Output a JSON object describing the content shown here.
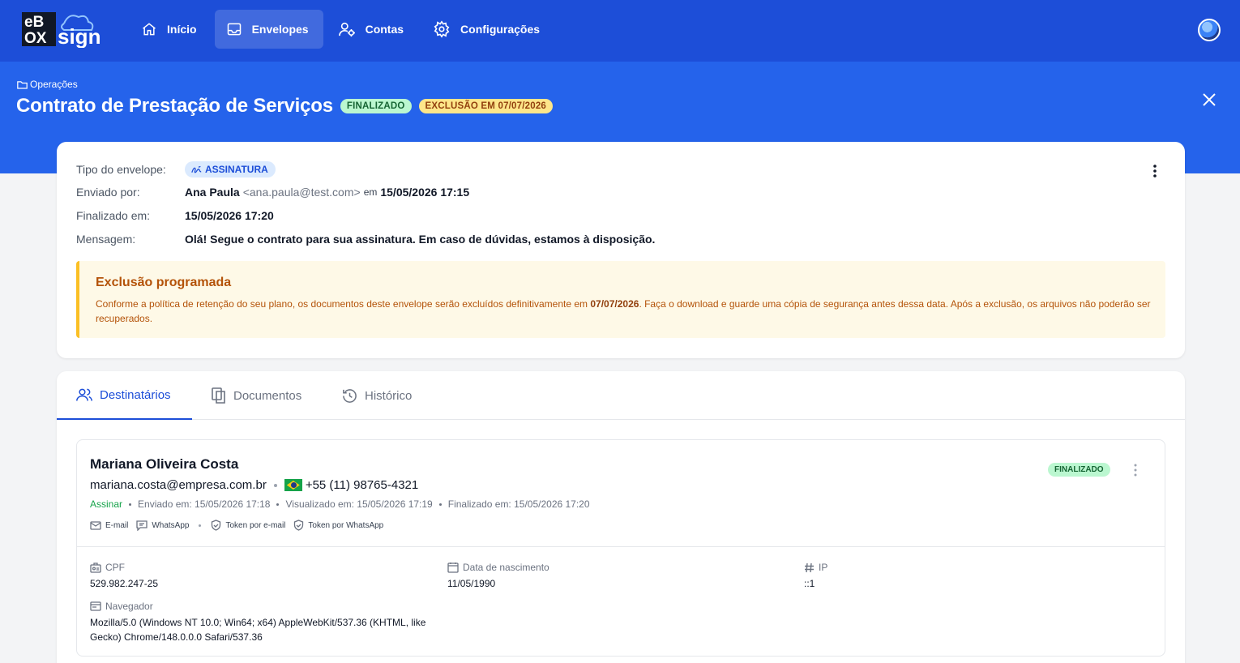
{
  "app": {
    "logo": {
      "line1": "eB",
      "line2": "OX",
      "brand": "sign"
    },
    "nav": [
      {
        "label": "Início",
        "icon": "home-icon"
      },
      {
        "label": "Envelopes",
        "icon": "inbox-icon",
        "active": true
      },
      {
        "label": "Contas",
        "icon": "users-gear-icon"
      },
      {
        "label": "Configurações",
        "icon": "gear-icon"
      }
    ]
  },
  "header": {
    "breadcrumb": "Operações",
    "title": "Contrato de Prestação de Serviços",
    "status_badge": "FINALIZADO",
    "deletion_badge": "EXCLUSÃO EM 07/07/2026"
  },
  "envelope": {
    "type_label": "Tipo do envelope:",
    "type_value": "ASSINATURA",
    "sent_by_label": "Enviado por:",
    "sender_name": "Ana Paula",
    "sender_email": "<ana.paula@test.com>",
    "sent_at_prefix": "em",
    "sent_at": "15/05/2026 17:15",
    "finalized_label": "Finalizado em:",
    "finalized_at": "15/05/2026 17:20",
    "message_label": "Mensagem:",
    "message": "Olá! Segue o contrato para sua assinatura. Em caso de dúvidas, estamos à disposição."
  },
  "alert": {
    "title": "Exclusão programada",
    "text_before": "Conforme a política de retenção do seu plano, os documentos deste envelope serão excluídos definitivamente em ",
    "date": "07/07/2026",
    "text_after": ". Faça o download e guarde uma cópia de segurança antes dessa data. Após a exclusão, os arquivos não poderão ser recuperados."
  },
  "tabs": [
    {
      "label": "Destinatários",
      "active": true
    },
    {
      "label": "Documentos"
    },
    {
      "label": "Histórico"
    }
  ],
  "recipient": {
    "name": "Mariana Oliveira Costa",
    "email": "mariana.costa@empresa.com.br",
    "phone": "+55 (11) 98765-4321",
    "action": "Assinar",
    "sent": "Enviado em: 15/05/2026 17:18",
    "viewed": "Visualizado em: 15/05/2026 17:19",
    "finalized": "Finalizado em: 15/05/2026 17:20",
    "channels": [
      "E-mail",
      "WhatsApp"
    ],
    "tokens": [
      "Token por e-mail",
      "Token por WhatsApp"
    ],
    "badge": "FINALIZADO",
    "fields": {
      "cpf_label": "CPF",
      "cpf": "529.982.247-25",
      "birth_label": "Data de nascimento",
      "birth": "11/05/1990",
      "ip_label": "IP",
      "ip": "::1",
      "browser_label": "Navegador",
      "browser": "Mozilla/5.0 (Windows NT 10.0; Win64; x64) AppleWebKit/537.36 (KHTML, like Gecko) Chrome/148.0.0.0 Safari/537.36"
    }
  },
  "colors": {
    "nav_bg": "#1d4ed8",
    "header_bg": "#2563eb",
    "success": "#16a34a",
    "warning": "#b45309"
  }
}
